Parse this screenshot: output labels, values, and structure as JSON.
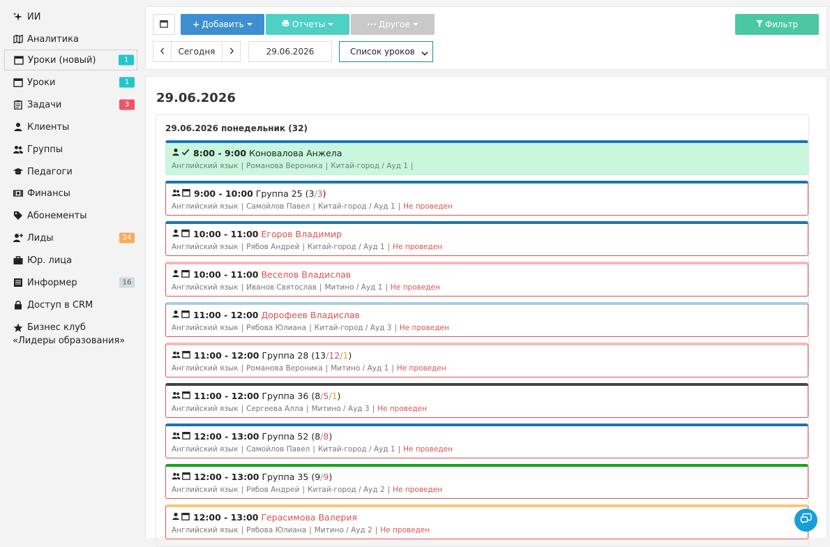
{
  "sidebar": {
    "items": [
      {
        "label": "ИИ",
        "icon": "sparkle-icon",
        "badge": null
      },
      {
        "label": "Аналитика",
        "icon": "map-icon",
        "badge": null
      },
      {
        "label": "Уроки (новый)",
        "icon": "calendar-icon",
        "badge": "1",
        "badge_color": "#23c6c8",
        "active": true
      },
      {
        "label": "Уроки",
        "icon": "calendar-icon",
        "badge": "1",
        "badge_color": "#23c6c8"
      },
      {
        "label": "Задачи",
        "icon": "clipboard-icon",
        "badge": "3",
        "badge_color": "#ed5565"
      },
      {
        "label": "Клиенты",
        "icon": "user-icon",
        "badge": null
      },
      {
        "label": "Группы",
        "icon": "users-icon",
        "badge": null
      },
      {
        "label": "Педагоги",
        "icon": "graduation-cap-icon",
        "badge": null
      },
      {
        "label": "Финансы",
        "icon": "money-icon",
        "badge": null
      },
      {
        "label": "Абонементы",
        "icon": "tag-icon",
        "badge": null
      },
      {
        "label": "Лиды",
        "icon": "user-plus-icon",
        "badge": "24",
        "badge_color": "#f8ac59"
      },
      {
        "label": "Юр. лица",
        "icon": "briefcase-icon",
        "badge": null
      },
      {
        "label": "Информер",
        "icon": "newspaper-icon",
        "badge": "16",
        "badge_color": "#d1dade"
      },
      {
        "label": "Доступ в CRM",
        "icon": "lock-icon",
        "badge": null
      }
    ],
    "club": {
      "line1": "Бизнес клуб",
      "line2": "«Лидеры образования»",
      "icon": "star-icon"
    }
  },
  "toolbar": {
    "add_label": "Добавить",
    "reports_label": "Отчеты",
    "other_label": "Другое",
    "filter_label": "Фильтр",
    "today_label": "Сегодня",
    "date_value": "29.06.2026",
    "view_select": "Список уроков",
    "colors": {
      "add": "#3d8fd0",
      "reports": "#4fd0c4",
      "other": "#c9c9c9",
      "filter": "#4cc7a4"
    }
  },
  "main": {
    "title": "29.06.2026",
    "day_title": "29.06.2026 понедельник (32)",
    "lessons": [
      {
        "type": "individual",
        "done": true,
        "time": "8:00 - 9:00",
        "name": "Коноваловa Анжела",
        "name_red": false,
        "subject": "Английский язык",
        "teacher": "Романова Вероника",
        "location": "Китай-город / Ауд 1",
        "status": "",
        "top_color": "#1a73b4"
      },
      {
        "type": "group",
        "time": "9:00 - 10:00",
        "name": "Группа 25",
        "counts": [
          "3",
          "3"
        ],
        "subject": "Английский язык",
        "teacher": "Самойлов Павел",
        "location": "Китай-город / Ауд 1",
        "status": "Не проведен",
        "top_color": "#1a73b4"
      },
      {
        "type": "individual",
        "time": "10:00 - 11:00",
        "name": "Егоров Владимир",
        "name_red": true,
        "subject": "Английский язык",
        "teacher": "Рябов Андрей",
        "location": "Китай-город / Ауд 1",
        "status": "Не проведен",
        "top_color": "#1a73b4"
      },
      {
        "type": "individual",
        "time": "10:00 - 11:00",
        "name": "Веселов Владислав",
        "name_red": true,
        "subject": "Английский язык",
        "teacher": "Иванов Святослав",
        "location": "Митино / Ауд 1",
        "status": "Не проведен",
        "top_color": "#f6b8b8"
      },
      {
        "type": "individual",
        "time": "11:00 - 12:00",
        "name": "Дорофеев Владислав",
        "name_red": true,
        "subject": "Английский язык",
        "teacher": "Рябова Юлиана",
        "location": "Китай-город / Ауд 3",
        "status": "Не проведен",
        "top_color": "#a9cfe5"
      },
      {
        "type": "group",
        "time": "11:00 - 12:00",
        "name": "Группа 28",
        "counts": [
          "13",
          "12",
          "1"
        ],
        "subject": "Английский язык",
        "teacher": "Романова Вероника",
        "location": "Митино / Ауд 1",
        "status": "Не проведен",
        "top_color": "#f6b8b8"
      },
      {
        "type": "group",
        "time": "11:00 - 12:00",
        "name": "Группа 36",
        "counts": [
          "8",
          "5",
          "1"
        ],
        "subject": "Английский язык",
        "teacher": "Сергеева Алла",
        "location": "Митино / Ауд 3",
        "status": "Не проведен",
        "top_color": "#444444"
      },
      {
        "type": "group",
        "time": "12:00 - 13:00",
        "name": "Группа 52",
        "counts": [
          "8",
          "8"
        ],
        "subject": "Английский язык",
        "teacher": "Самойлов Павел",
        "location": "Китай-город / Ауд 1",
        "status": "Не проведен",
        "top_color": "#1a73b4"
      },
      {
        "type": "group",
        "time": "12:00 - 13:00",
        "name": "Группа 35",
        "counts": [
          "9",
          "9"
        ],
        "subject": "Английский язык",
        "teacher": "Рябов Андрей",
        "location": "Китай-город / Ауд 2",
        "status": "Не проведен",
        "top_color": "#1aa01a"
      },
      {
        "type": "individual",
        "time": "12:00 - 13:00",
        "name": "Герасимова Валерия",
        "name_red": true,
        "subject": "Английский язык",
        "teacher": "Рябова Юлиана",
        "location": "Митино / Ауд 2",
        "status": "Не проведен",
        "top_color": "#f8c87a"
      }
    ]
  }
}
